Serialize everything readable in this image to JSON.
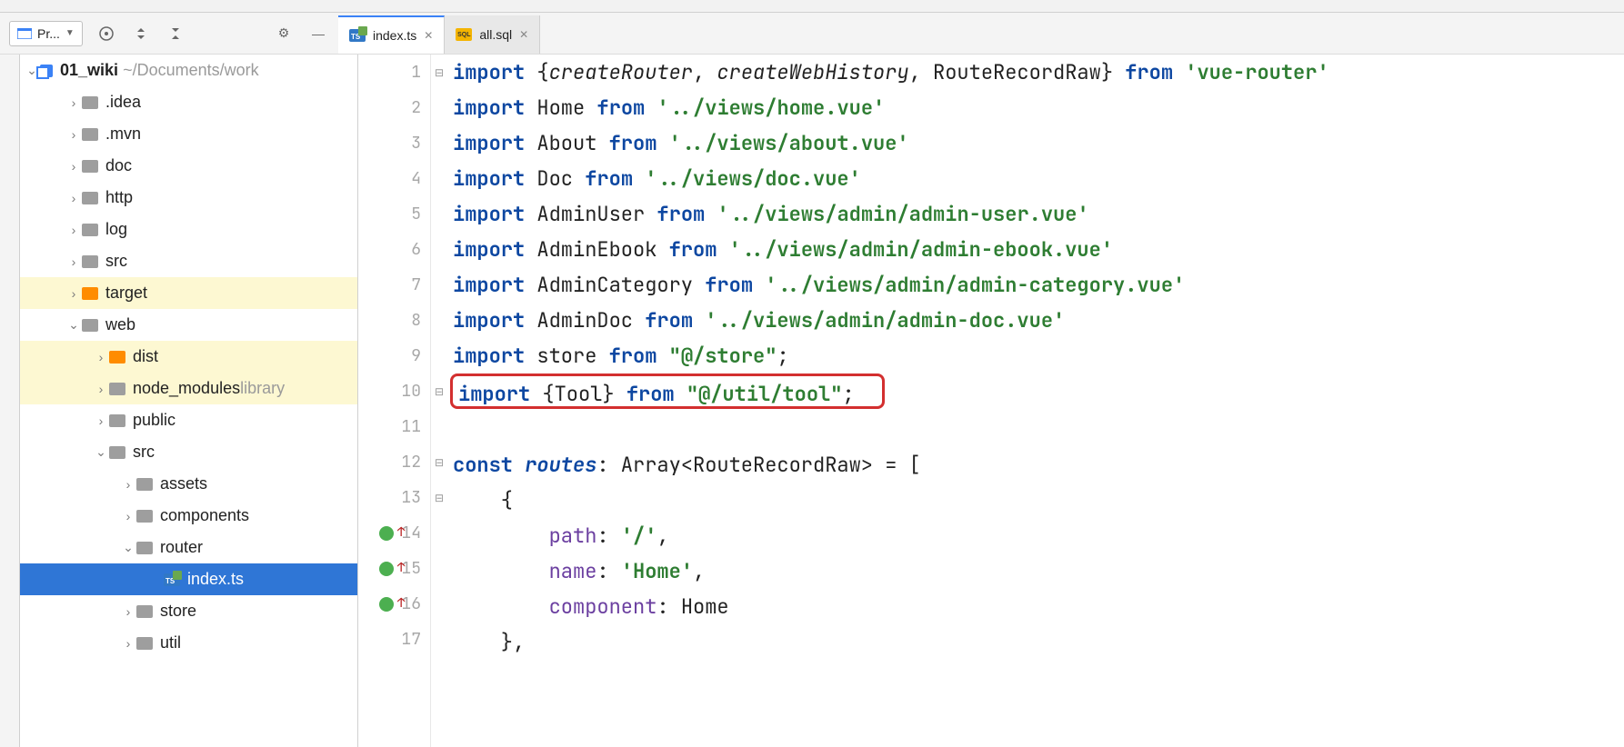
{
  "toolbar": {
    "project_selector_label": "Pr...",
    "tab1_label": "index.ts",
    "tab2_label": "all.sql"
  },
  "tree": {
    "root_name": "01_wiki",
    "root_path": "~/Documents/work",
    "items": [
      {
        "name": ".idea",
        "depth": 1,
        "expand": "collapsed",
        "color": "gray"
      },
      {
        "name": ".mvn",
        "depth": 1,
        "expand": "collapsed",
        "color": "gray"
      },
      {
        "name": "doc",
        "depth": 1,
        "expand": "collapsed",
        "color": "gray"
      },
      {
        "name": "http",
        "depth": 1,
        "expand": "collapsed",
        "color": "gray"
      },
      {
        "name": "log",
        "depth": 1,
        "expand": "collapsed",
        "color": "gray"
      },
      {
        "name": "src",
        "depth": 1,
        "expand": "collapsed",
        "color": "gray"
      },
      {
        "name": "target",
        "depth": 1,
        "expand": "collapsed",
        "color": "orange",
        "hl": true
      },
      {
        "name": "web",
        "depth": 1,
        "expand": "expanded",
        "color": "gray"
      },
      {
        "name": "dist",
        "depth": 2,
        "expand": "collapsed",
        "color": "orange",
        "hl": true
      },
      {
        "name": "node_modules",
        "suffix": "library",
        "depth": 2,
        "expand": "collapsed",
        "color": "gray",
        "hl": true
      },
      {
        "name": "public",
        "depth": 2,
        "expand": "collapsed",
        "color": "gray"
      },
      {
        "name": "src",
        "depth": 2,
        "expand": "expanded",
        "color": "gray"
      },
      {
        "name": "assets",
        "depth": 3,
        "expand": "collapsed",
        "color": "gray"
      },
      {
        "name": "components",
        "depth": 3,
        "expand": "collapsed",
        "color": "gray"
      },
      {
        "name": "router",
        "depth": 3,
        "expand": "expanded",
        "color": "gray"
      },
      {
        "name": "index.ts",
        "depth": 4,
        "expand": "none",
        "file": true,
        "selected": true
      },
      {
        "name": "store",
        "depth": 3,
        "expand": "collapsed",
        "color": "gray"
      },
      {
        "name": "util",
        "depth": 3,
        "expand": "collapsed",
        "color": "gray"
      }
    ]
  },
  "code": {
    "lines": [
      {
        "n": 1,
        "fold": true,
        "tokens": [
          [
            "kw",
            "import "
          ],
          [
            "op",
            "{"
          ],
          [
            "fn-it",
            "createRouter"
          ],
          [
            "op",
            ", "
          ],
          [
            "fn-it",
            "createWebHistory"
          ],
          [
            "op",
            ", RouteRecordRaw} "
          ],
          [
            "kw",
            "from "
          ],
          [
            "str",
            "'vue-router'"
          ]
        ]
      },
      {
        "n": 2,
        "tokens": [
          [
            "kw",
            "import "
          ],
          [
            "op",
            "Home "
          ],
          [
            "kw",
            "from "
          ],
          [
            "str",
            "'../views/home.vue'"
          ]
        ]
      },
      {
        "n": 3,
        "tokens": [
          [
            "kw",
            "import "
          ],
          [
            "op",
            "About "
          ],
          [
            "kw",
            "from "
          ],
          [
            "str",
            "'../views/about.vue'"
          ]
        ]
      },
      {
        "n": 4,
        "tokens": [
          [
            "kw",
            "import "
          ],
          [
            "op",
            "Doc "
          ],
          [
            "kw",
            "from "
          ],
          [
            "str",
            "'../views/doc.vue'"
          ]
        ]
      },
      {
        "n": 5,
        "tokens": [
          [
            "kw",
            "import "
          ],
          [
            "op",
            "AdminUser "
          ],
          [
            "kw",
            "from "
          ],
          [
            "str",
            "'../views/admin/admin-user.vue'"
          ]
        ]
      },
      {
        "n": 6,
        "tokens": [
          [
            "kw",
            "import "
          ],
          [
            "op",
            "AdminEbook "
          ],
          [
            "kw",
            "from "
          ],
          [
            "str",
            "'../views/admin/admin-ebook.vue'"
          ]
        ]
      },
      {
        "n": 7,
        "tokens": [
          [
            "kw",
            "import "
          ],
          [
            "op",
            "AdminCategory "
          ],
          [
            "kw",
            "from "
          ],
          [
            "str",
            "'../views/admin/admin-category.vue'"
          ]
        ]
      },
      {
        "n": 8,
        "tokens": [
          [
            "kw",
            "import "
          ],
          [
            "op",
            "AdminDoc "
          ],
          [
            "kw",
            "from "
          ],
          [
            "str",
            "'../views/admin/admin-doc.vue'"
          ]
        ]
      },
      {
        "n": 9,
        "tokens": [
          [
            "kw",
            "import "
          ],
          [
            "op",
            "store "
          ],
          [
            "kw",
            "from "
          ],
          [
            "str",
            "\"@/store\""
          ],
          [
            "op",
            ";"
          ]
        ]
      },
      {
        "n": 10,
        "boxed": true,
        "fold": true,
        "tokens": [
          [
            "kw",
            "import "
          ],
          [
            "op",
            "{Tool} "
          ],
          [
            "kw",
            "from "
          ],
          [
            "str",
            "\"@/util/tool\""
          ],
          [
            "op",
            ";"
          ]
        ]
      },
      {
        "n": 11,
        "tokens": []
      },
      {
        "n": 12,
        "fold": true,
        "tokens": [
          [
            "kw",
            "const "
          ],
          [
            "kw-it",
            "routes"
          ],
          [
            "op",
            ": Array<RouteRecordRaw> = ["
          ]
        ]
      },
      {
        "n": 13,
        "fold": true,
        "tokens": [
          [
            "op",
            "    {"
          ]
        ]
      },
      {
        "n": 14,
        "mark": true,
        "tokens": [
          [
            "op",
            "        "
          ],
          [
            "prop",
            "path"
          ],
          [
            "op",
            ": "
          ],
          [
            "str",
            "'/'"
          ],
          [
            "op",
            ","
          ]
        ]
      },
      {
        "n": 15,
        "mark": true,
        "tokens": [
          [
            "op",
            "        "
          ],
          [
            "prop",
            "name"
          ],
          [
            "op",
            ": "
          ],
          [
            "str",
            "'Home'"
          ],
          [
            "op",
            ","
          ]
        ]
      },
      {
        "n": 16,
        "mark": true,
        "tokens": [
          [
            "op",
            "        "
          ],
          [
            "prop",
            "component"
          ],
          [
            "op",
            ": Home"
          ]
        ]
      },
      {
        "n": 17,
        "tokens": [
          [
            "op",
            "    },"
          ]
        ]
      }
    ]
  }
}
